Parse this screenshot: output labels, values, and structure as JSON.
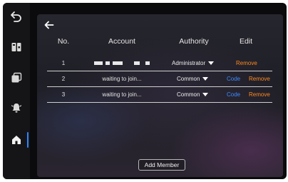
{
  "sidebar": {
    "items": [
      {
        "icon": "back-arrow-icon"
      },
      {
        "icon": "intercom-panel-icon"
      },
      {
        "icon": "layers-icon"
      },
      {
        "icon": "bell-icon"
      },
      {
        "icon": "home-icon",
        "active": true
      }
    ]
  },
  "panel": {
    "back_icon": "left-arrow-icon",
    "table": {
      "headers": {
        "no": "No.",
        "account": "Account",
        "authority": "Authority",
        "edit": "Edit"
      },
      "rows": [
        {
          "no": "1",
          "account": "",
          "authority": "Administrator",
          "code": "",
          "remove": "Remove"
        },
        {
          "no": "2",
          "account": "waiting to join...",
          "authority": "Common",
          "code": "Code",
          "remove": "Remove"
        },
        {
          "no": "3",
          "account": "waiting to join...",
          "authority": "Common",
          "code": "Code",
          "remove": "Remove"
        }
      ]
    },
    "add_member_label": "Add Member"
  },
  "colors": {
    "code_link": "#3d8bff",
    "remove_link": "#ff8a1f",
    "active_indicator": "#2f86ff"
  }
}
